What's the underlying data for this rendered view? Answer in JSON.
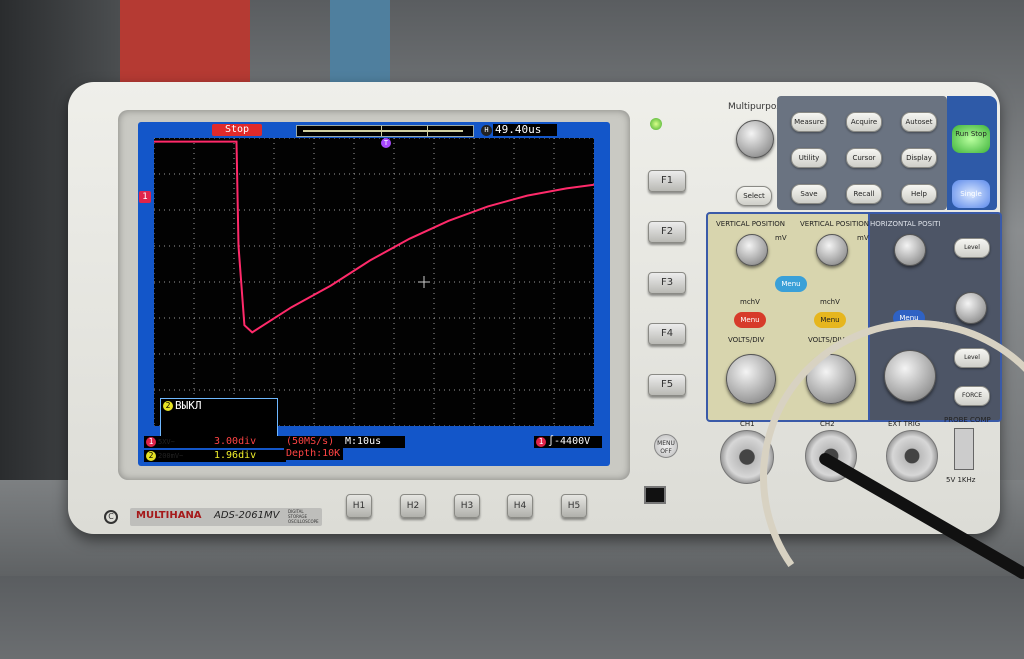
{
  "scope_screen": {
    "run_state": "Stop",
    "h_offset_badge": "H",
    "h_offset": "49.40us",
    "ch1_marker": "1",
    "trigger_marker": "T",
    "ch2_status": {
      "num": "2",
      "text": "ВЫКЛ"
    },
    "ch1": {
      "num": "1",
      "label": "5XV~",
      "value": "3.00div"
    },
    "ch2": {
      "num": "2",
      "label": "200mV~",
      "value": "1.96div"
    },
    "sample_rate": "(50MS/s)",
    "depth": "Depth:10K",
    "timebase": "M:10us",
    "trigger": {
      "num": "1",
      "text": "∫-4400V"
    },
    "trace_color": "#ff2a6a"
  },
  "waveform": {
    "type": "line",
    "x_unit": "div",
    "y_unit": "div",
    "points": [
      [
        0,
        3.9
      ],
      [
        2.1,
        3.9
      ],
      [
        2.15,
        1.0
      ],
      [
        2.3,
        -1.2
      ],
      [
        2.5,
        -1.4
      ],
      [
        3.5,
        -0.7
      ],
      [
        4.5,
        -0.1
      ],
      [
        5.5,
        0.6
      ],
      [
        6.5,
        1.2
      ],
      [
        7.5,
        1.7
      ],
      [
        8.5,
        2.1
      ],
      [
        9.5,
        2.4
      ],
      [
        10.5,
        2.6
      ],
      [
        11.2,
        2.7
      ]
    ]
  },
  "softkeys": [
    "F1",
    "F2",
    "F3",
    "F4",
    "F5"
  ],
  "hkeys": [
    "H1",
    "H2",
    "H3",
    "H4",
    "H5"
  ],
  "menu_off": "MENU OFF",
  "branding": {
    "logo": "MULTIHANA",
    "model": "ADS-2061MV",
    "desc": "DIGITAL STORAGE OSCILLOSCOPE"
  },
  "panel": {
    "multipurpose": "Multipurpose",
    "select": "Select",
    "buttons": [
      "Measure",
      "Acquire",
      "Autoset",
      "Utility",
      "Cursor",
      "Display",
      "Save",
      "Recall",
      "Help"
    ],
    "run_stop": "Run Stop",
    "single": "Single",
    "vertical_position": "VERTICAL POSITION",
    "horizontal_position": "HORIZONTAL POSITION",
    "menu": "Menu",
    "level": "Level",
    "force": "FORCE",
    "mchv": "mchV",
    "mv": "mV",
    "volts_div": "VOLTS/DIV",
    "ch1": "CH1",
    "ch2": "CH2",
    "ext_trig": "EXT TRIG",
    "probe_comp": "PROBE COMP",
    "probe_comp_spec": "5V 1KHz"
  }
}
